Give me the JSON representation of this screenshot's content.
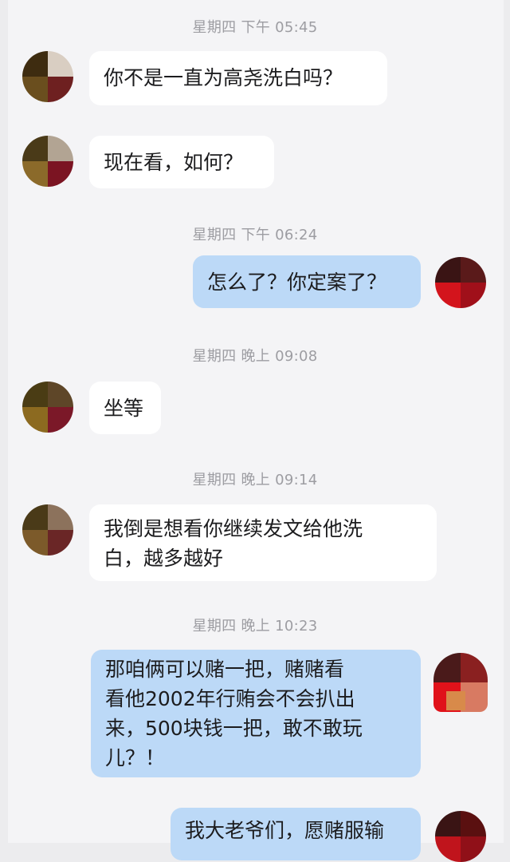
{
  "messages": [
    {
      "time": "星期四 下午 05:45",
      "from": "them",
      "text": "你不是一直为高尧洗白吗？"
    },
    {
      "from": "them",
      "text": "现在看，如何？"
    },
    {
      "time": "星期四 下午 06:24",
      "from": "me",
      "text": "怎么了？你定案了？"
    },
    {
      "time": "星期四 晚上 09:08",
      "from": "them",
      "text": "坐等"
    },
    {
      "time": "星期四 晚上 09:14",
      "from": "them",
      "lines": [
        "我倒是想看你继续发文给他洗",
        "白，越多越好"
      ]
    },
    {
      "time": "星期四 晚上 10:23",
      "from": "me",
      "lines": [
        "那咱俩可以赌一把，赌赌看",
        "看他2002年行贿会不会扒出",
        "来，500块钱一把，敢不敢玩",
        "儿？！"
      ]
    },
    {
      "from": "me",
      "text": "我大老爷们，愿赌服输"
    }
  ],
  "colors": {
    "incoming_bubble": "#ffffff",
    "outgoing_bubble": "#bcd9f7",
    "timestamp": "#9d9da2",
    "background": "#f4f4f6"
  },
  "avatars": {
    "them": "pixelated-avatar-icon",
    "me": "pixelated-avatar-icon"
  }
}
